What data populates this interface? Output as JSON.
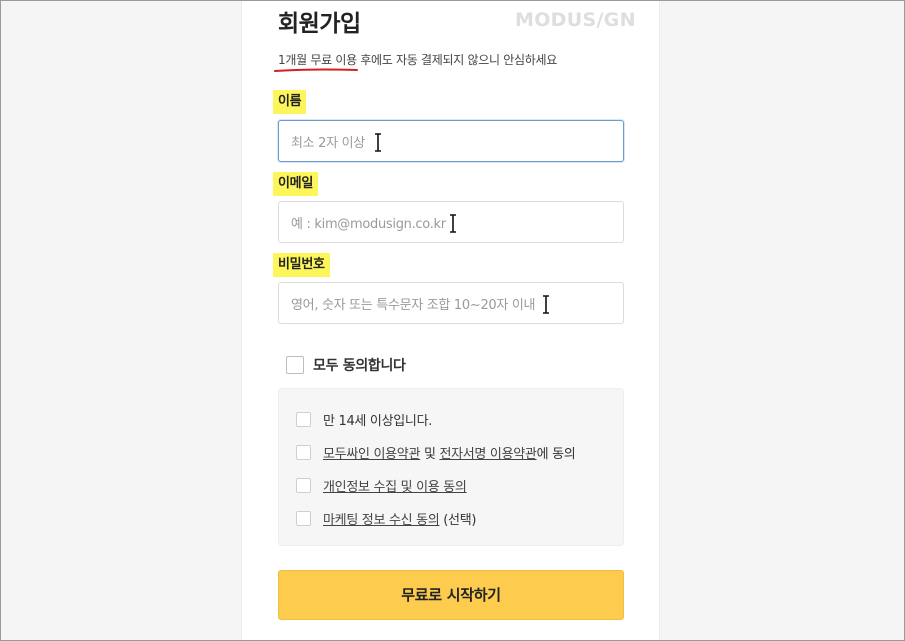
{
  "header": {
    "title": "회원가입",
    "logo": "MODUS/GN",
    "subtitle": "1개월 무료 이용 후에도 자동 결제되지 않으니 안심하세요"
  },
  "form": {
    "name": {
      "label": "이름",
      "placeholder": "최소 2자 이상"
    },
    "email": {
      "label": "이메일",
      "placeholder": "예 : kim@modusign.co.kr"
    },
    "password": {
      "label": "비밀번호",
      "placeholder": "영어, 숫자 또는 특수문자 조합 10~20자 이내"
    }
  },
  "agreements": {
    "all_label": "모두 동의합니다",
    "age_label": "만 14세 이상입니다.",
    "terms": {
      "link1": "모두싸인 이용약관",
      "mid": " 및 ",
      "link2": "전자서명 이용약관",
      "suffix": "에 동의"
    },
    "privacy_link": "개인정보 수집 및 이용 동의",
    "marketing": {
      "link": "마케팅 정보 수신 동의",
      "suffix": " (선택)"
    }
  },
  "submit_label": "무료로 시작하기",
  "colors": {
    "label_highlight": "#fdf65a",
    "button": "#fdcc4e",
    "focus_border": "#6c9bd2",
    "annotation_underline": "#d81e1e"
  }
}
